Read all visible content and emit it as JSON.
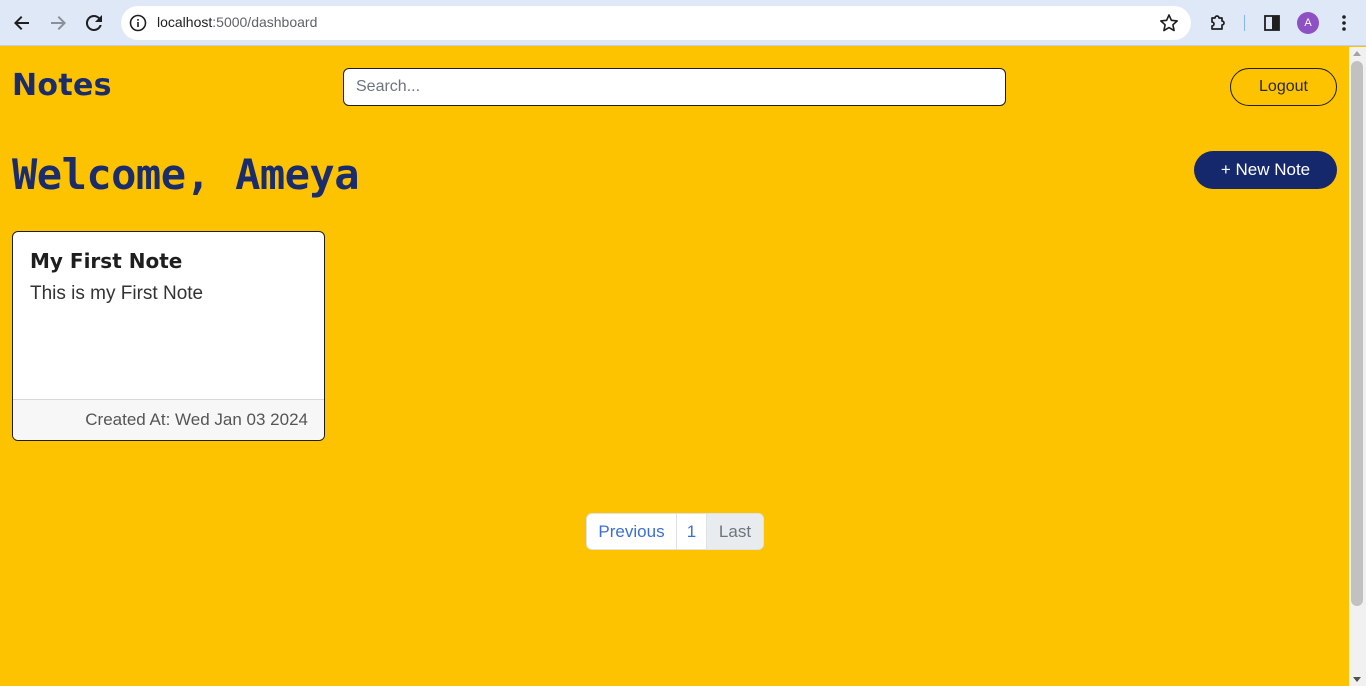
{
  "browser": {
    "url_host": "localhost",
    "url_path": ":5000/dashboard",
    "profile_initial": "A"
  },
  "header": {
    "brand": "Notes",
    "search_placeholder": "Search...",
    "logout_label": "Logout"
  },
  "main": {
    "welcome": "Welcome, Ameya",
    "new_note_label": "+ New Note"
  },
  "notes": [
    {
      "title": "My First Note",
      "body": "This is my First Note",
      "created": "Created At: Wed Jan 03 2024"
    }
  ],
  "pagination": {
    "previous": "Previous",
    "page": "1",
    "last": "Last"
  },
  "colors": {
    "background": "#fdc300",
    "brand": "#1a2c6b",
    "button": "#14286b"
  },
  "icons": [
    "back-arrow-icon",
    "forward-arrow-icon",
    "reload-icon",
    "info-icon",
    "star-icon",
    "extensions-icon",
    "side-panel-icon",
    "more-vert-icon"
  ]
}
